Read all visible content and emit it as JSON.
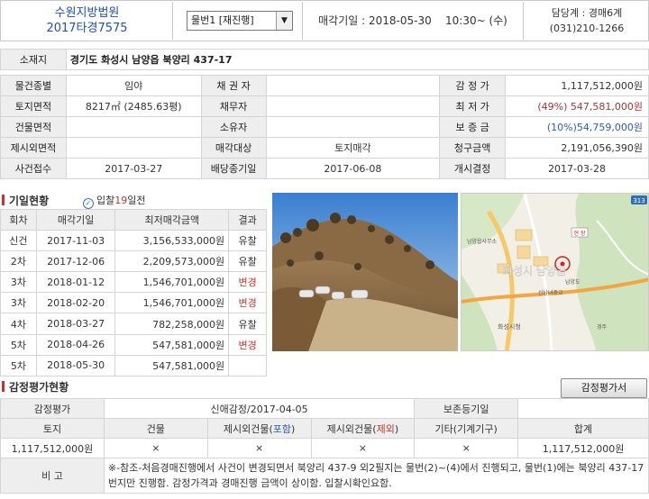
{
  "header": {
    "court": "수원지방법원",
    "case_no": "2017타경7575",
    "item_select": "물번1 [재진행]",
    "auction_date_label": "매각기일 :",
    "auction_date": "2018-05-30",
    "auction_time": "10:30~ (수)",
    "dept": "담당계 : 경매6계",
    "phone": "(031)210-1266"
  },
  "info": {
    "location_label": "소재지",
    "location": "경기도 화성시 남양읍 북양리 437-17",
    "type_label": "물건종별",
    "type": "임야",
    "creditor_label": "채 권 자",
    "creditor": "",
    "appraisal_label": "감 정 가",
    "appraisal": "1,117,512,000원",
    "land_area_label": "토지면적",
    "land_area": "8217㎡ (2485.63평)",
    "debtor_label": "채무자",
    "debtor": "",
    "min_price_label": "최 저 가",
    "min_price_pct": "(49%)",
    "min_price": "547,581,000원",
    "bldg_area_label": "건물면적",
    "bldg_area": "",
    "owner_label": "소유자",
    "owner": "",
    "deposit_label": "보 증 금",
    "deposit": "(10%)54,759,000원",
    "excl_area_label": "제시외면적",
    "excl_area": "",
    "sale_target_label": "매각대상",
    "sale_target": "토지매각",
    "claim_label": "청구금액",
    "claim": "2,191,056,390원",
    "received_label": "사건접수",
    "received": "2017-03-27",
    "dist_deadline_label": "배당종기일",
    "dist_deadline": "2017-06-08",
    "commence_label": "개시결정",
    "commence": "2017-03-28"
  },
  "history": {
    "title": "기일현황",
    "sub_prefix": "입찰",
    "sub_days": "19",
    "sub_suffix": "일전",
    "headers": [
      "회차",
      "매각기일",
      "최저매각금액",
      "결과"
    ],
    "rows": [
      [
        "신건",
        "2017-11-03",
        "3,156,533,000원",
        "유찰"
      ],
      [
        "2차",
        "2017-12-06",
        "2,209,573,000원",
        "유찰"
      ],
      [
        "3차",
        "2018-01-12",
        "1,546,701,000원",
        "변경"
      ],
      [
        "3차",
        "2018-02-20",
        "1,546,701,000원",
        "변경"
      ],
      [
        "4차",
        "2018-03-27",
        "782,258,000원",
        "유찰"
      ],
      [
        "5차",
        "2018-04-26",
        "547,581,000원",
        "변경"
      ],
      [
        "5차",
        "2018-05-30",
        "547,581,000원",
        ""
      ]
    ]
  },
  "map": {
    "labels": [
      "화성시 남양읍",
      "화성시청",
      "남양읍사무소",
      "현 장",
      "남양도",
      "신남녀중교",
      "경주"
    ],
    "road": "313"
  },
  "appraisal": {
    "title": "감정평가현황",
    "button": "감정평가서",
    "eval_label": "감정평가",
    "eval_value": "신애감정/2017-04-05",
    "preserve_label": "보존등기일",
    "preserve_value": "",
    "col_land": "토지",
    "col_bldg": "건물",
    "col_incl_prefix": "제시외건물(",
    "col_incl": "포함",
    "col_excl_prefix": "제시외건물(",
    "col_excl": "제외",
    "col_suffix": ")",
    "col_etc": "기타(기계기구)",
    "col_total": "합계",
    "v_land": "1,117,512,000원",
    "v_bldg": "×",
    "v_incl": "×",
    "v_excl": "×",
    "v_etc": "×",
    "v_total": "1,117,512,000원",
    "note_label": "비 고",
    "note": "※-참조-처음경매진행에서 사건이 변경되면서 북양리 437-9 외2필지는 물번(2)~(4)에서 진행되고, 물번(1)에는 북양리 437-17번지만 진행함. 감정가격과 경매진행 금액이 상이함. 입찰시확인요함."
  },
  "colors": {
    "accent_blue": "#1f4fb5",
    "accent_red": "#c0392b",
    "label_bg": "#eeeeee"
  }
}
